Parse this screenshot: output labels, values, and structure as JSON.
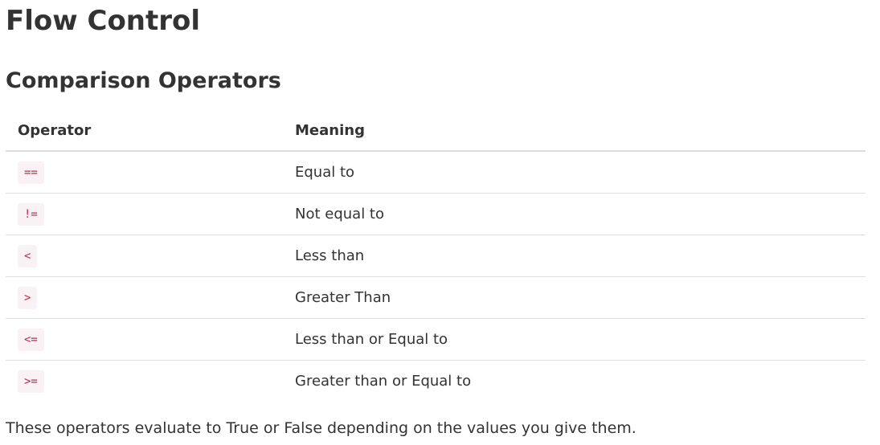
{
  "page": {
    "title": "Flow Control",
    "section_title": "Comparison Operators",
    "footer": "These operators evaluate to True or False depending on the values you give them."
  },
  "table": {
    "headers": [
      "Operator",
      "Meaning"
    ],
    "rows": [
      {
        "operator": "==",
        "meaning": "Equal to"
      },
      {
        "operator": "!=",
        "meaning": "Not equal to"
      },
      {
        "operator": "<",
        "meaning": "Less than"
      },
      {
        "operator": ">",
        "meaning": "Greater Than"
      },
      {
        "operator": "<=",
        "meaning": "Less than or Equal to"
      },
      {
        "operator": ">=",
        "meaning": "Greater than or Equal to"
      }
    ]
  },
  "colors": {
    "text": "#333333",
    "code_text": "#c7254e",
    "code_background": "#f9f2f4",
    "border": "#dddddd"
  }
}
